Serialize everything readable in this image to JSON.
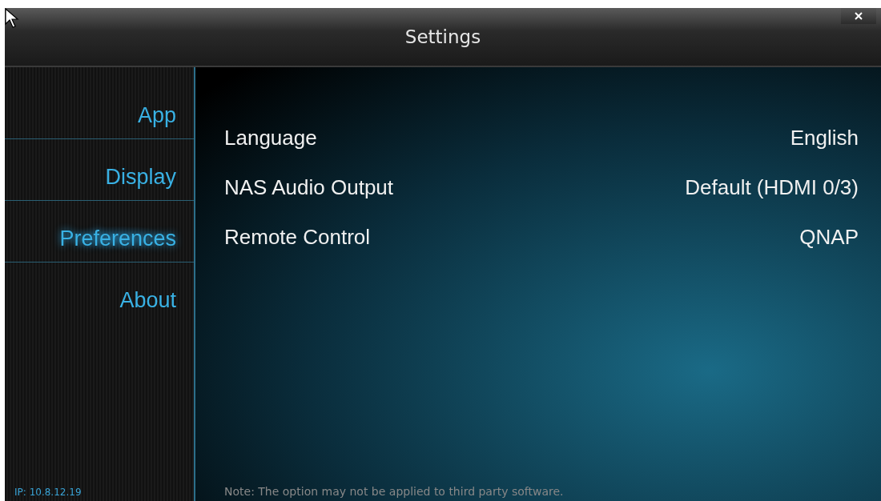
{
  "window": {
    "title": "Settings"
  },
  "sidebar": {
    "items": [
      {
        "label": "App",
        "selected": false
      },
      {
        "label": "Display",
        "selected": false
      },
      {
        "label": "Preferences",
        "selected": true
      },
      {
        "label": "About",
        "selected": false
      }
    ],
    "ip": "IP: 10.8.12.19"
  },
  "settings": [
    {
      "label": "Language",
      "value": "English"
    },
    {
      "label": "NAS Audio Output",
      "value": "Default (HDMI 0/3)"
    },
    {
      "label": "Remote Control",
      "value": "QNAP"
    }
  ],
  "note": "Note: The option may not be applied to third party software."
}
